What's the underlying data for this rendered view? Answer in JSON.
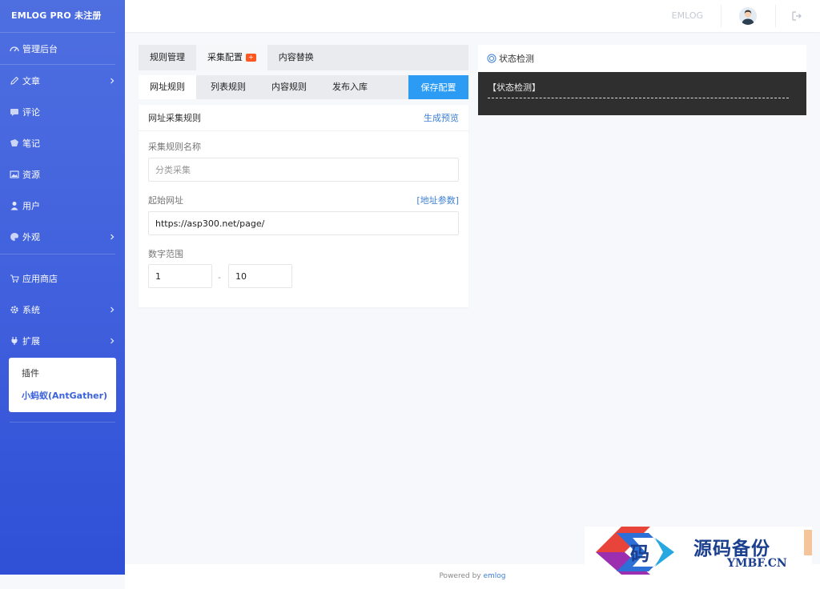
{
  "sidebar": {
    "brand": "EMLOG PRO 未注册",
    "items": [
      {
        "label": "管理后台"
      },
      {
        "label": "文章"
      },
      {
        "label": "评论"
      },
      {
        "label": "笔记"
      },
      {
        "label": "资源"
      },
      {
        "label": "用户"
      },
      {
        "label": "外观"
      },
      {
        "label": "应用商店"
      },
      {
        "label": "系统"
      },
      {
        "label": "扩展"
      }
    ],
    "submenu": [
      {
        "label": "插件"
      },
      {
        "label": "小蚂蚁(AntGather)"
      }
    ]
  },
  "topbar": {
    "site_name": "EMLOG"
  },
  "tabs_primary": [
    {
      "label": "规则管理"
    },
    {
      "label": "采集配置",
      "badge": "+"
    },
    {
      "label": "内容替换"
    }
  ],
  "tabs_secondary": [
    {
      "label": "网址规则"
    },
    {
      "label": "列表规则"
    },
    {
      "label": "内容规则"
    },
    {
      "label": "发布入库"
    }
  ],
  "save_button": "保存配置",
  "card": {
    "title": "网址采集规则",
    "preview_link": "生成预览",
    "rule_name_label": "采集规则名称",
    "rule_name_placeholder": "分类采集",
    "start_url_label": "起始网址",
    "url_params_link": "[地址参数]",
    "start_url_value": "https://asp300.net/page/",
    "range_label": "数字范围",
    "range_from": "1",
    "range_sep": "-",
    "range_to": "10"
  },
  "status": {
    "title": "状态检测",
    "body_text": "【状态检测】"
  },
  "footer": {
    "prefix": "Powered by",
    "brand": "emlog"
  },
  "watermark": {
    "glyph": "码",
    "title": "源码备份",
    "subtitle": "YMBF.CN"
  },
  "colors": {
    "sidebar_top": "#4e6fe0",
    "sidebar_bottom": "#2f4fd6",
    "accent": "#2b9bf4",
    "link": "#3c80d6",
    "badge": "#ff5722",
    "status_bg": "#2f2f2f"
  }
}
